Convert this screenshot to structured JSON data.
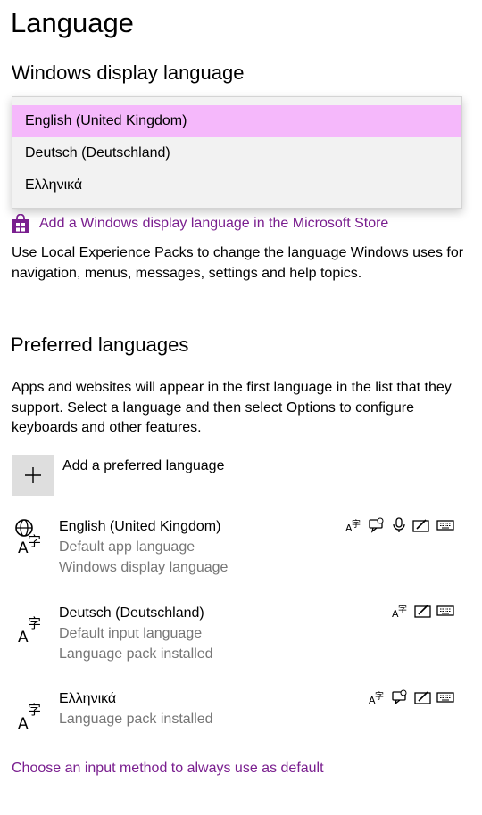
{
  "page": {
    "title": "Language"
  },
  "display_language": {
    "heading": "Windows display language",
    "options": [
      "English (United Kingdom)",
      "Deutsch (Deutschland)",
      "Ελληνικά"
    ],
    "selected_index": 0,
    "store_link": "Add a Windows display language in the Microsoft Store",
    "description": "Use Local Experience Packs to change the language Windows uses for navigation, menus, messages, settings and help topics."
  },
  "preferred": {
    "heading": "Preferred languages",
    "description": "Apps and websites will appear in the first language in the list that they support. Select a language and then select Options to configure keyboards and other features.",
    "add_label": "Add a preferred language",
    "languages": [
      {
        "name": "English (United Kingdom)",
        "lines": [
          "Default app language",
          "Windows display language"
        ],
        "features": [
          "text-to-speech-icon",
          "speech-bubble-icon",
          "microphone-icon",
          "handwriting-icon",
          "keyboard-icon"
        ]
      },
      {
        "name": "Deutsch (Deutschland)",
        "lines": [
          "Default input language",
          "Language pack installed"
        ],
        "features": [
          "text-to-speech-icon",
          "handwriting-icon",
          "keyboard-icon"
        ]
      },
      {
        "name": "Ελληνικά",
        "lines": [
          "Language pack installed"
        ],
        "features": [
          "text-to-speech-icon",
          "speech-bubble-icon",
          "handwriting-icon",
          "keyboard-icon"
        ]
      }
    ]
  },
  "footer": {
    "link": "Choose an input method to always use as default"
  },
  "colors": {
    "accent": "#7a1f8f",
    "selected": "#f5b8fb",
    "muted": "#767676",
    "button_bg": "#dedede"
  }
}
